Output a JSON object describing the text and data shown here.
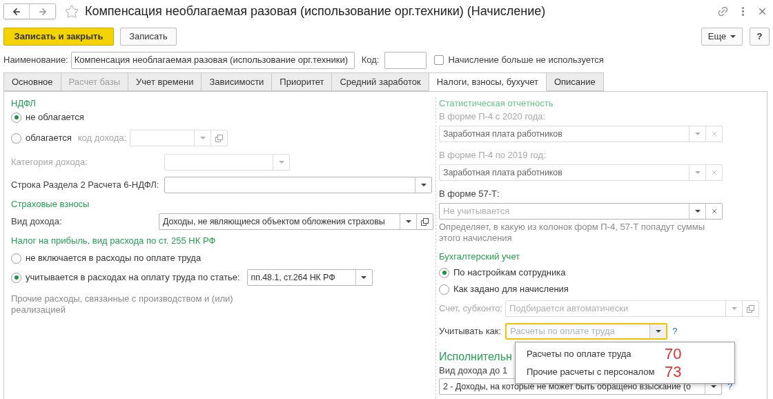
{
  "window": {
    "title": "Компенсация необлагаемая разовая (использование орг.техники) (Начисление)"
  },
  "toolbar": {
    "primary_button": "Записать и закрыть",
    "save_button": "Записать",
    "more_button": "Еще",
    "help_button": "?"
  },
  "header": {
    "name_label": "Наименование:",
    "name_value": "Компенсация необлагаемая разовая (использование орг.техники)",
    "code_label": "Код:",
    "unused_checkbox": {
      "label": "Начисление больше не используется",
      "checked": false
    }
  },
  "tabs": [
    {
      "label": "Основное",
      "selected": false,
      "disabled": false
    },
    {
      "label": "Расчет базы",
      "selected": false,
      "disabled": true
    },
    {
      "label": "Учет времени",
      "selected": false,
      "disabled": false
    },
    {
      "label": "Зависимости",
      "selected": false,
      "disabled": false
    },
    {
      "label": "Приоритет",
      "selected": false,
      "disabled": false
    },
    {
      "label": "Средний заработок",
      "selected": false,
      "disabled": false
    },
    {
      "label": "Налоги, взносы, бухучет",
      "selected": true,
      "disabled": false
    },
    {
      "label": "Описание",
      "selected": false,
      "disabled": false
    }
  ],
  "left": {
    "ndfl": {
      "heading": "НДФЛ",
      "options": [
        {
          "label": "не облагается",
          "selected": true
        },
        {
          "label": "облагается",
          "selected": false
        }
      ],
      "income_code": {
        "label": "код дохода:",
        "kind": "select_open",
        "disabled": true
      },
      "income_category": {
        "label": "Категория дохода:",
        "kind": "select",
        "disabled": true
      },
      "line_6ndfl": {
        "label": "Строка Раздела 2 Расчета 6-НДФЛ:",
        "kind": "select",
        "disabled": false
      }
    },
    "insurance": {
      "heading": "Страховые взносы",
      "income_type": {
        "label": "Вид дохода:",
        "value": "Доходы, не являющиеся объектом обложения страховы",
        "kind": "select_open",
        "disabled": false
      }
    },
    "profit_tax": {
      "heading": "Налог на прибыль, вид расхода по ст. 255 НК РФ",
      "options": [
        {
          "label": "не включается в расходы по оплате труда",
          "selected": false
        },
        {
          "label": "учитывается в расходах на оплату труда по статье:",
          "selected": true
        }
      ],
      "article": {
        "value": "пп.48.1, ст.264 НК РФ",
        "kind": "select",
        "disabled": false
      },
      "note": "Прочие расходы, связанные с производством и (или) реализацией"
    }
  },
  "right": {
    "statistics": {
      "heading": "Статистическая отчетность",
      "fields": [
        {
          "label": "В форме П-4 с 2020 года:",
          "value": "Заработная плата работников",
          "kind": "select_clear",
          "disabled": true
        },
        {
          "label": "В форме П-4 по 2019 год:",
          "value": "Заработная плата работников",
          "kind": "select_clear",
          "disabled": true
        },
        {
          "label": "В форме 57-Т:",
          "placeholder": "Не учитывается",
          "kind": "select_clear",
          "disabled": false
        }
      ],
      "note": "Определяет, в какую из колонок форм П-4, 57-Т попадут суммы этого начисления"
    },
    "accounting": {
      "heading": "Бухгалтерский учет",
      "options": [
        {
          "label": "По настройкам сотрудника",
          "selected": true
        },
        {
          "label": "Как задано для начисления",
          "selected": false
        }
      ],
      "account": {
        "label": "Счет, субконто:",
        "placeholder": "Подбирается автоматически",
        "kind": "select_open",
        "disabled": true
      },
      "account_as": {
        "label": "Учитывать как:",
        "placeholder": "Расчеты по оплате труда",
        "kind": "select",
        "disabled": false,
        "focused": true,
        "help": "?"
      }
    },
    "enforcement": {
      "heading": "Исполнительн",
      "income_label": "Вид дохода до 1",
      "income": {
        "value": "2 - Доходы, на которые не может быть обращено взыскание (о",
        "kind": "select",
        "disabled": false,
        "help": "?"
      }
    }
  },
  "popup": {
    "items": [
      {
        "label": "Расчеты по оплате труда",
        "annotation": "70"
      },
      {
        "label": "Прочие расчеты с персоналом",
        "annotation": "73"
      }
    ]
  }
}
